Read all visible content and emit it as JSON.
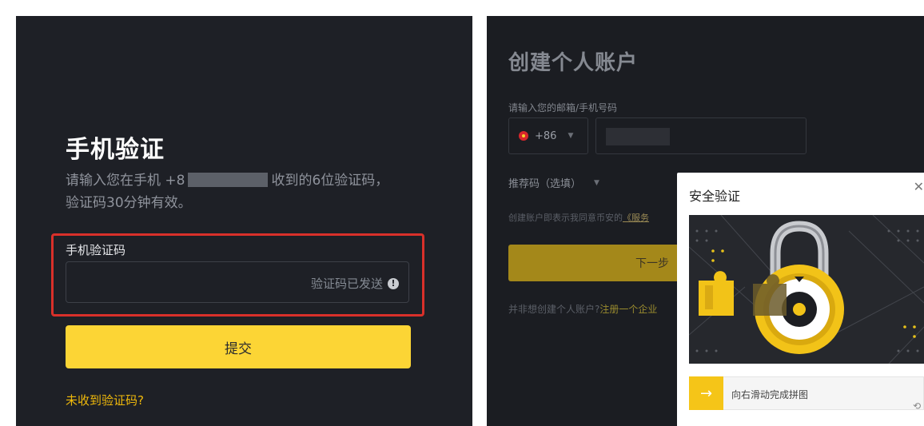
{
  "left_panel": {
    "title": "手机验证",
    "desc_part1": "请输入您在手机 +8",
    "desc_part2": "收到的6位验证码，",
    "desc_line2": "验证码30分钟有效。",
    "code_label": "手机验证码",
    "code_status": "验证码已发送",
    "submit_label": "提交",
    "resend_link": "未收到验证码?",
    "highlight_color": "#d9302a",
    "accent_color": "#fcd535"
  },
  "right_panel": {
    "title": "创建个人账户",
    "input_label": "请输入您的邮箱/手机号码",
    "country_code": "+86",
    "referral_label": "推荐码（选填）",
    "terms_text": "创建账户即表示我同意币安的",
    "terms_link": "《服务",
    "next_label": "下一步",
    "alt_text": "并非想创建个人账户?",
    "alt_link": "注册一个企业",
    "modal": {
      "title": "安全验证",
      "slider_hint": "向右滑动完成拼图"
    }
  }
}
